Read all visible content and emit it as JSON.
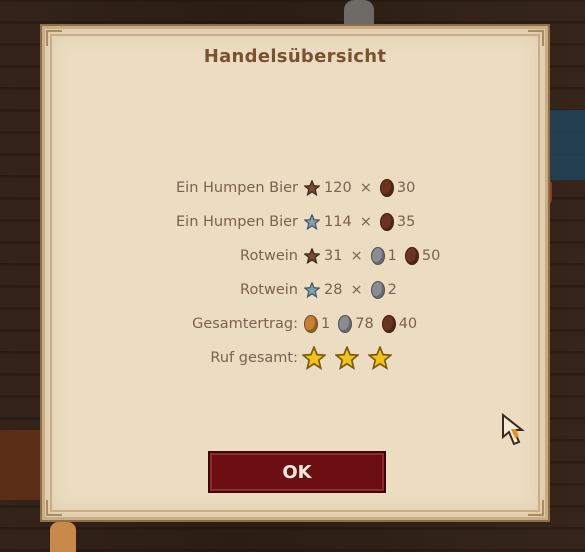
{
  "dialog": {
    "title": "Handelsübersicht",
    "ok_label": "OK"
  },
  "rows": [
    {
      "label": "Ein Humpen Bier",
      "star": "bronze-star-icon",
      "qty": "120",
      "coins": [
        {
          "kind": "bronze",
          "value": "30"
        }
      ]
    },
    {
      "label": "Ein Humpen Bier",
      "star": "silver-star-icon",
      "qty": "114",
      "coins": [
        {
          "kind": "bronze",
          "value": "35"
        }
      ]
    },
    {
      "label": "Rotwein",
      "star": "bronze-star-icon",
      "qty": "31",
      "coins": [
        {
          "kind": "silver",
          "value": "1"
        },
        {
          "kind": "bronze",
          "value": "50"
        }
      ]
    },
    {
      "label": "Rotwein",
      "star": "silver-star-icon",
      "qty": "28",
      "coins": [
        {
          "kind": "silver",
          "value": "2"
        }
      ]
    }
  ],
  "total": {
    "label": "Gesamtertrag:",
    "gold": "1",
    "silver": "78",
    "bronze": "40"
  },
  "reputation": {
    "label": "Ruf gesamt:",
    "stars": 3
  },
  "times_symbol": "×",
  "colors": {
    "parchment": "#ecdcc1",
    "title": "#7a5230",
    "text": "#7a6250",
    "button": "#6b0f12",
    "gold_star": "#f2c21a"
  }
}
